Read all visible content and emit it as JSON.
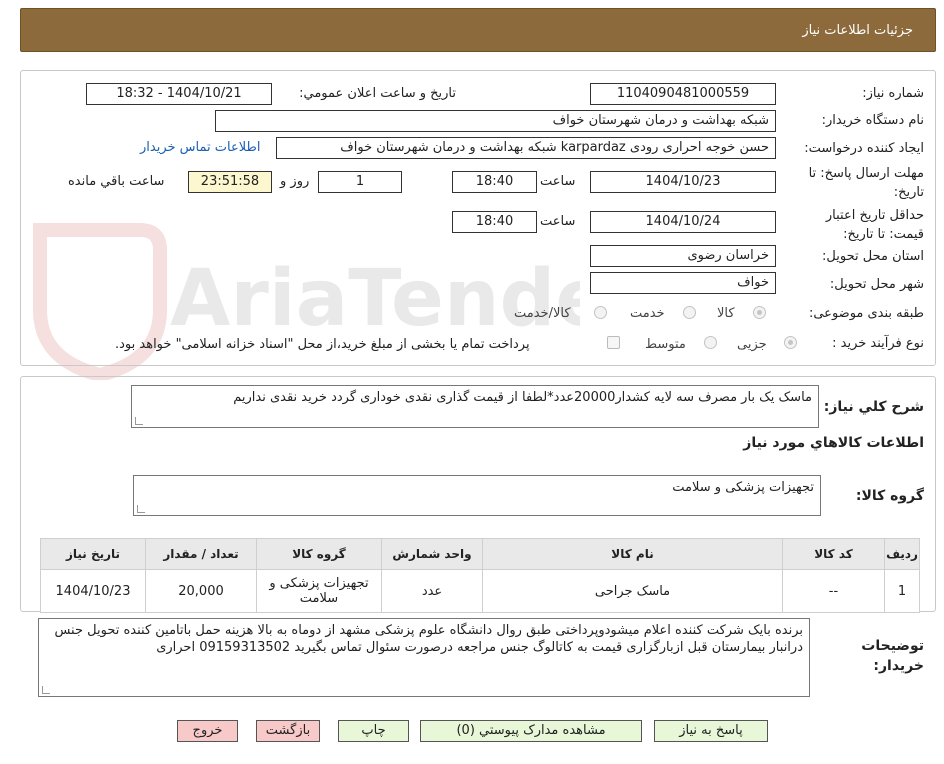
{
  "header": {
    "title": "جزئیات اطلاعات نیاز"
  },
  "watermark": {
    "text": "AriaTender.neT"
  },
  "form": {
    "need_number_label": "شماره نیاز:",
    "need_number": "1104090481000559",
    "announce_label": "تاریخ و ساعت اعلان عمومي:",
    "announce_value": "1404/10/21 - 18:32",
    "buyer_org_label": "نام دستگاه خريدار:",
    "buyer_org": "شبکه بهداشت و درمان شهرستان خواف",
    "requester_label": "ایجاد کننده درخواست:",
    "requester": "حسن خوجه احراری رودی karpardaz شبکه بهداشت و درمان شهرستان خواف",
    "contact_link": "اطلاعات تماس خریدار",
    "deadline_label": "مهلت ارسال پاسخ: تا تاریخ:",
    "deadline_date": "1404/10/23",
    "time_label": "ساعت",
    "deadline_time": "18:40",
    "days_value": "1",
    "days_label": "روز و",
    "remaining_time": "23:51:58",
    "remaining_label": "ساعت باقي مانده",
    "validity_label": "حداقل تاريخ اعتبار قيمت: تا تاريخ:",
    "validity_date": "1404/10/24",
    "validity_time": "18:40",
    "province_label": "استان محل تحويل:",
    "province": "خراسان رضوی",
    "city_label": "شهر محل تحويل:",
    "city": "خواف",
    "category_label": "طبقه بندی موضوعی:",
    "category_options": [
      "کالا",
      "خدمت",
      "کالا/خدمت"
    ],
    "process_label": "نوع فرآیند خرید :",
    "process_options": [
      "جزیی",
      "متوسط"
    ],
    "payment_note": "پرداخت تمام یا بخشی از مبلغ خرید،از محل \"اسناد خزانه اسلامی\" خواهد بود."
  },
  "summary": {
    "label": "شرح کلي نياز:",
    "text": "ماسک یک بار مصرف سه لایه  کشدار20000عدد*لطفا از قیمت گذاری نقدی خوداری گردد خرید نقدی نداریم"
  },
  "items_section": {
    "title": "اطلاعات کالاهاي مورد نياز"
  },
  "group": {
    "label": "گروه کالا:",
    "value": "تجهیزات پزشکی و سلامت"
  },
  "table": {
    "headers": [
      "ردیف",
      "کد کالا",
      "نام کالا",
      "واحد شمارش",
      "گروه کالا",
      "تعداد / مقدار",
      "تاریخ نیاز"
    ],
    "rows": [
      [
        "1",
        "--",
        "ماسک جراحی",
        "عدد",
        "تجهیزات پزشکی و سلامت",
        "20,000",
        "1404/10/23"
      ]
    ]
  },
  "buyer_notes": {
    "label": "توضيحات خريدار:",
    "text": "برنده بایک شرکت کننده اعلام میشودوپرداختی طبق روال دانشگاه علوم پزشکی مشهد از دوماه به بالا هزینه حمل باتامین کننده تحویل جنس درانبار بیمارستان قبل ازبارگزاری قیمت به کاتالوگ جنس مراجعه درصورت سئوال تماس بگیرید 09159313502 احراری"
  },
  "buttons": {
    "reply": "پاسخ به نياز",
    "attachments": "مشاهده مدارک پيوستي (0)",
    "print": "چاپ",
    "back": "بازگشت",
    "exit": "خروج"
  }
}
